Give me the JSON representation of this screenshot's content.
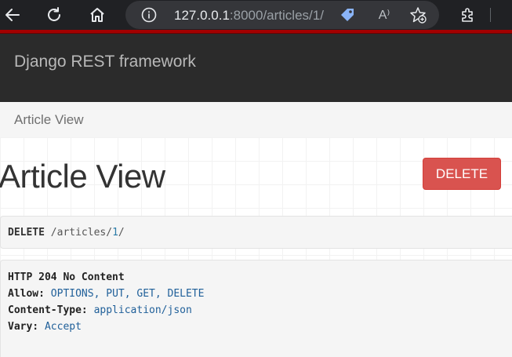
{
  "browser": {
    "url_host": "127.0.0.1",
    "url_rest": ":8000/articles/1/",
    "icons": [
      "back-arrow-icon",
      "reload-icon",
      "home-icon",
      "info-icon",
      "tag-icon",
      "read-aloud-icon",
      "favorites-add-icon",
      "extensions-icon"
    ],
    "read_aloud_glyph": "A⁾"
  },
  "site": {
    "brand": "Django REST framework",
    "breadcrumb": "Article View",
    "page_title": "Article View",
    "delete_label": "DELETE",
    "accent_color": "#a30000",
    "delete_color": "#d9534f"
  },
  "request": {
    "method": "DELETE",
    "path_prefix": "/articles/",
    "path_id": "1",
    "path_suffix": "/"
  },
  "response": {
    "status": "HTTP 204 No Content",
    "headers": [
      {
        "key": "Allow:",
        "value": "OPTIONS, PUT, GET, DELETE"
      },
      {
        "key": "Content-Type:",
        "value": "application/json"
      },
      {
        "key": "Vary:",
        "value": "Accept"
      }
    ]
  }
}
